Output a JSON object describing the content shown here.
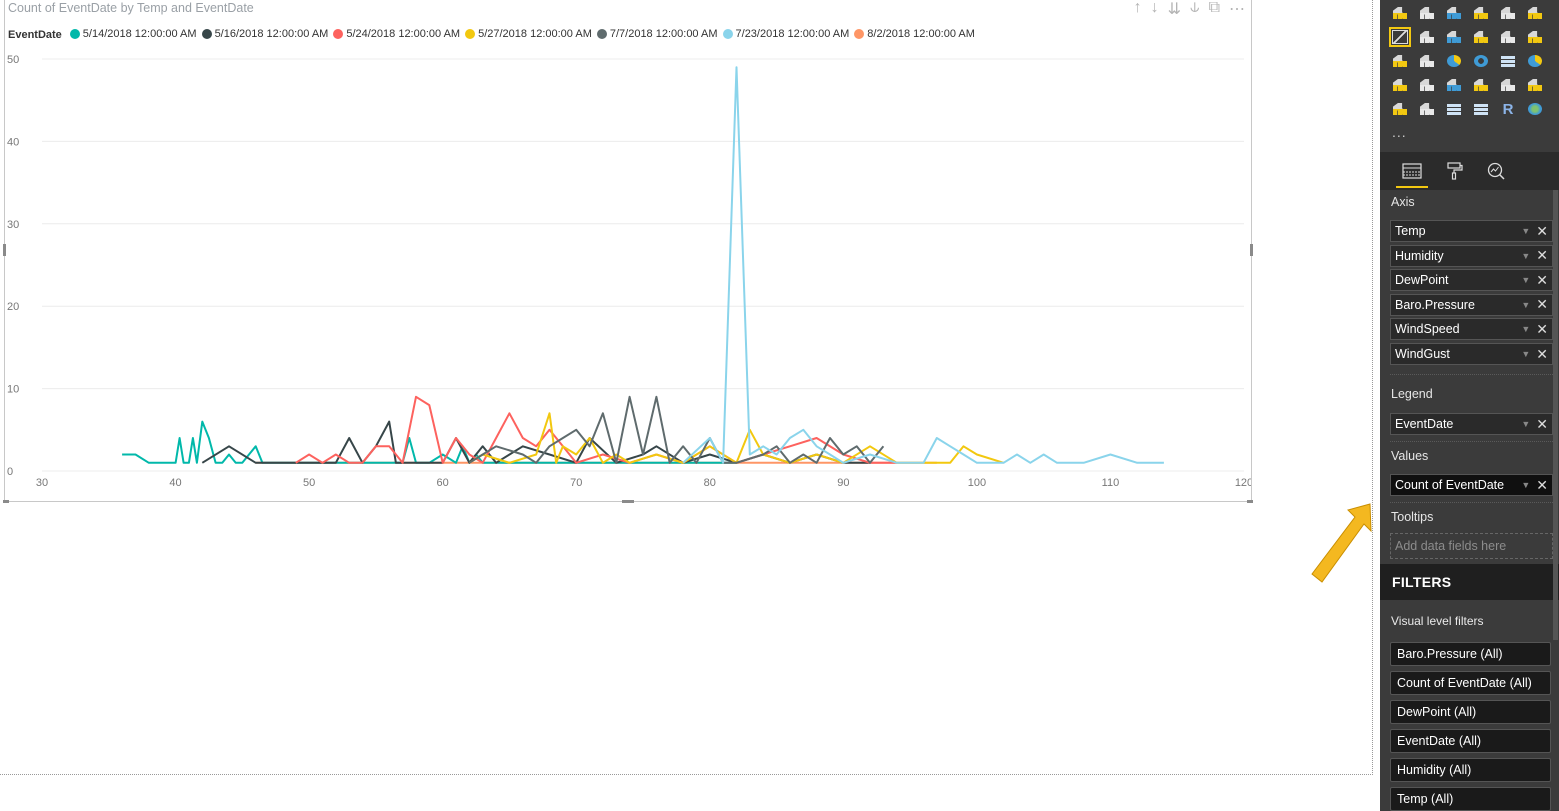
{
  "visual": {
    "title": "Count of EventDate by Temp and EventDate",
    "legend_title": "EventDate",
    "legend_items": [
      {
        "label": "5/14/2018 12:00:00 AM",
        "color": "#01B8AA"
      },
      {
        "label": "5/16/2018 12:00:00 AM",
        "color": "#374649"
      },
      {
        "label": "5/24/2018 12:00:00 AM",
        "color": "#FD625E"
      },
      {
        "label": "5/27/2018 12:00:00 AM",
        "color": "#F2C80F"
      },
      {
        "label": "7/7/2018 12:00:00 AM",
        "color": "#5F6B6D"
      },
      {
        "label": "7/23/2018 12:00:00 AM",
        "color": "#8AD4EB"
      },
      {
        "label": "8/2/2018 12:00:00 AM",
        "color": "#FE9666"
      }
    ],
    "header_icons": [
      "arrow-up-icon",
      "arrow-down-icon",
      "double-arrow-down-icon",
      "expand-hierarchy-icon",
      "focus-mode-icon",
      "more-options-icon"
    ]
  },
  "chart_data": {
    "type": "line",
    "title": "Count of EventDate by Temp and EventDate",
    "xlabel": "",
    "ylabel": "",
    "xlim": [
      30,
      120
    ],
    "ylim": [
      0,
      50
    ],
    "xticks": [
      30,
      40,
      50,
      60,
      70,
      80,
      90,
      100,
      110,
      120
    ],
    "yticks": [
      0,
      10,
      20,
      30,
      40,
      50
    ],
    "grid": true,
    "legend_position": "top-left",
    "series": [
      {
        "name": "5/14/2018 12:00:00 AM",
        "color": "#01B8AA",
        "x": [
          36,
          37,
          38,
          39,
          40,
          40.3,
          40.6,
          41,
          41.3,
          41.6,
          42,
          42.5,
          43,
          43.5,
          44,
          44.5,
          45,
          45.5,
          46,
          46.5,
          47,
          48,
          56,
          57,
          57.5,
          58,
          59,
          60,
          61,
          61.5,
          62,
          62.5,
          63,
          65,
          67,
          70,
          73,
          77,
          82
        ],
        "y": [
          2,
          2,
          1,
          1,
          1,
          4,
          1,
          1,
          4,
          1,
          6,
          4,
          1,
          1,
          2,
          1,
          1,
          2,
          3,
          1,
          1,
          1,
          1,
          1,
          4,
          1,
          1,
          2,
          1,
          3,
          1,
          2,
          1,
          1,
          1,
          1,
          1,
          1,
          1
        ]
      },
      {
        "name": "5/16/2018 12:00:00 AM",
        "color": "#374649",
        "x": [
          42,
          44,
          46,
          47,
          52,
          53,
          54,
          55,
          56,
          56.5,
          60,
          61,
          62,
          63,
          64,
          66,
          68,
          70,
          71,
          73,
          75,
          76,
          78,
          80,
          82,
          84,
          86,
          88,
          90,
          92
        ],
        "y": [
          1,
          3,
          1,
          1,
          1,
          4,
          1,
          3,
          6,
          1,
          1,
          4,
          1,
          3,
          1,
          3,
          2,
          1,
          4,
          1,
          2,
          3,
          1,
          2,
          1,
          2,
          1,
          2,
          1,
          1
        ]
      },
      {
        "name": "5/24/2018 12:00:00 AM",
        "color": "#FD625E",
        "x": [
          49,
          50,
          51,
          52,
          53,
          54,
          55,
          56,
          57,
          58,
          59,
          60,
          61,
          62,
          63,
          64,
          65,
          66,
          67,
          68,
          69,
          70,
          72,
          74,
          76,
          78,
          80,
          82,
          84,
          86,
          88,
          90,
          92,
          94
        ],
        "y": [
          1,
          2,
          1,
          2,
          1,
          1,
          3,
          3,
          1,
          9,
          8,
          1,
          4,
          2,
          1,
          4,
          7,
          4,
          3,
          5,
          3,
          1,
          2,
          1,
          2,
          1,
          3,
          1,
          2,
          3,
          4,
          2,
          1,
          1
        ]
      },
      {
        "name": "5/27/2018 12:00:00 AM",
        "color": "#F2C80F",
        "x": [
          62,
          63,
          65,
          67,
          68,
          68.5,
          69,
          70,
          71,
          72,
          73,
          74,
          76,
          78,
          80,
          82,
          83,
          84,
          86,
          88,
          90,
          92,
          94,
          96,
          98,
          99,
          100,
          102
        ],
        "y": [
          1,
          2,
          1,
          2,
          7,
          1,
          3,
          2,
          4,
          1,
          2,
          1,
          2,
          1,
          3,
          1,
          5,
          2,
          1,
          2,
          1,
          3,
          1,
          1,
          1,
          3,
          2,
          1
        ]
      },
      {
        "name": "7/7/2018 12:00:00 AM",
        "color": "#5F6B6D",
        "x": [
          62,
          63,
          64,
          66,
          67,
          68,
          69,
          70,
          71,
          72,
          73,
          74,
          75,
          76,
          77,
          78,
          79,
          80,
          81,
          82,
          84,
          85,
          86,
          87,
          88,
          89,
          90,
          91,
          92,
          93
        ],
        "y": [
          1,
          2,
          3,
          2,
          1,
          3,
          4,
          5,
          3,
          7,
          1,
          9,
          2,
          9,
          1,
          3,
          1,
          4,
          1,
          1,
          2,
          3,
          1,
          2,
          1,
          4,
          2,
          3,
          1,
          3
        ]
      },
      {
        "name": "7/23/2018 12:00:00 AM",
        "color": "#8AD4EB",
        "x": [
          78,
          80,
          81,
          82,
          83,
          84,
          85,
          86,
          87,
          88,
          89,
          90,
          92,
          94,
          96,
          97,
          98,
          99,
          100,
          102,
          103,
          104,
          105,
          106,
          108,
          110,
          112,
          114
        ],
        "y": [
          1,
          4,
          1,
          49,
          2,
          3,
          2,
          4,
          5,
          3,
          2,
          1,
          2,
          1,
          1,
          4,
          3,
          2,
          1,
          1,
          2,
          1,
          2,
          1,
          1,
          2,
          1,
          1
        ]
      },
      {
        "name": "8/2/2018 12:00:00 AM",
        "color": "#FE9666",
        "x": [
          46,
          50,
          55,
          60,
          65,
          70,
          75,
          80,
          85,
          90,
          95,
          97
        ],
        "y": [
          1,
          1,
          1,
          1,
          1,
          1,
          1,
          1,
          1,
          1,
          1,
          1
        ]
      }
    ]
  },
  "pane": {
    "viz_rows": [
      [
        "stacked-bar-icon",
        "stacked-column-icon",
        "clustered-bar-icon",
        "clustered-column-icon",
        "100-stacked-bar-icon",
        "100-stacked-column-icon"
      ],
      [
        "line-chart-icon",
        "area-chart-icon",
        "stacked-area-icon",
        "line-clustered-column-icon",
        "line-stacked-column-icon",
        "ribbon-chart-icon"
      ],
      [
        "waterfall-icon",
        "scatter-icon",
        "pie-icon",
        "donut-icon",
        "treemap-icon",
        "map-icon"
      ],
      [
        "filled-map-icon",
        "shape-map-icon",
        "funnel-icon",
        "gauge-icon",
        "card-icon",
        "multi-row-card-icon"
      ],
      [
        "kpi-icon",
        "slicer-icon",
        "table-icon",
        "matrix-icon",
        "r-visual-icon",
        "globe-icon"
      ]
    ],
    "more_label": "...",
    "tabs": [
      "fields-tab-icon",
      "format-paint-icon",
      "analytics-icon"
    ],
    "axis_label": "Axis",
    "axis_fields": [
      "Temp",
      "Humidity",
      "DewPoint",
      "Baro.Pressure",
      "WindSpeed",
      "WindGust"
    ],
    "legend_label": "Legend",
    "legend_field": "EventDate",
    "values_label": "Values",
    "values_field": "Count of EventDate",
    "tooltips_label": "Tooltips",
    "tooltips_placeholder": "Add data fields here",
    "filters_title": "FILTERS",
    "visual_filters_label": "Visual level filters",
    "filter_items": [
      "Baro.Pressure (All)",
      "Count of EventDate (All)",
      "DewPoint (All)",
      "EventDate (All)",
      "Humidity (All)",
      "Temp (All)"
    ]
  },
  "annotation": {
    "arrow_color": "#F4B820"
  }
}
